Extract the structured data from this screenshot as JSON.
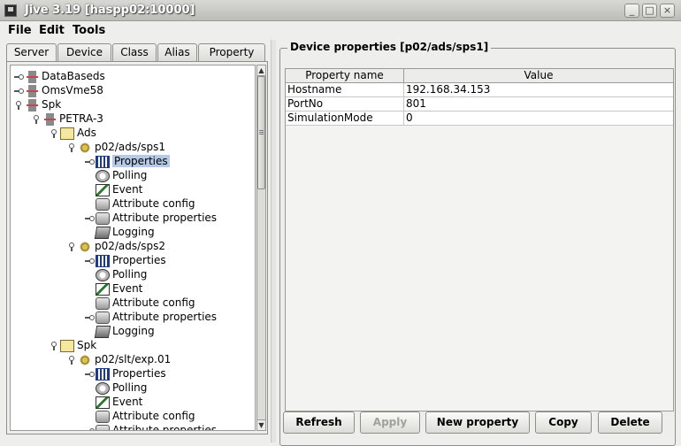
{
  "window": {
    "title": "Jive 3.19  [haspp02:10000]",
    "buttons": [
      "_",
      "□",
      "×"
    ]
  },
  "menu": [
    "File",
    "Edit",
    "Tools"
  ],
  "tabs": [
    {
      "label": "Server",
      "active": true
    },
    {
      "label": "Device",
      "active": false
    },
    {
      "label": "Class",
      "active": false
    },
    {
      "label": "Alias",
      "active": false
    },
    {
      "label": "Property",
      "active": false
    }
  ],
  "tree": [
    {
      "label": "DataBaseds",
      "icon": "server-icon",
      "level": 0,
      "state": "collapsed"
    },
    {
      "label": "OmsVme58",
      "icon": "server-icon",
      "level": 0,
      "state": "collapsed"
    },
    {
      "label": "Spk",
      "icon": "server-icon",
      "level": 0,
      "state": "expanded"
    },
    {
      "label": "PETRA-3",
      "icon": "instance-icon",
      "level": 1,
      "state": "expanded"
    },
    {
      "label": "Ads",
      "icon": "class-icon",
      "level": 2,
      "state": "expanded"
    },
    {
      "label": "p02/ads/sps1",
      "icon": "device-icon",
      "level": 3,
      "state": "expanded"
    },
    {
      "label": "Properties",
      "icon": "properties-icon",
      "level": 4,
      "state": "collapsed",
      "selected": true
    },
    {
      "label": "Polling",
      "icon": "polling-icon",
      "level": 4,
      "state": "none"
    },
    {
      "label": "Event",
      "icon": "event-icon",
      "level": 4,
      "state": "none"
    },
    {
      "label": "Attribute config",
      "icon": "attribute-config-icon",
      "level": 4,
      "state": "none"
    },
    {
      "label": "Attribute properties",
      "icon": "attribute-properties-icon",
      "level": 4,
      "state": "collapsed"
    },
    {
      "label": "Logging",
      "icon": "logging-icon",
      "level": 4,
      "state": "none"
    },
    {
      "label": "p02/ads/sps2",
      "icon": "device-icon",
      "level": 3,
      "state": "expanded"
    },
    {
      "label": "Properties",
      "icon": "properties-icon",
      "level": 4,
      "state": "collapsed"
    },
    {
      "label": "Polling",
      "icon": "polling-icon",
      "level": 4,
      "state": "none"
    },
    {
      "label": "Event",
      "icon": "event-icon",
      "level": 4,
      "state": "none"
    },
    {
      "label": "Attribute config",
      "icon": "attribute-config-icon",
      "level": 4,
      "state": "none"
    },
    {
      "label": "Attribute properties",
      "icon": "attribute-properties-icon",
      "level": 4,
      "state": "collapsed"
    },
    {
      "label": "Logging",
      "icon": "logging-icon",
      "level": 4,
      "state": "none"
    },
    {
      "label": "Spk",
      "icon": "class-icon",
      "level": 2,
      "state": "expanded"
    },
    {
      "label": "p02/slt/exp.01",
      "icon": "device-icon",
      "level": 3,
      "state": "expanded"
    },
    {
      "label": "Properties",
      "icon": "properties-icon",
      "level": 4,
      "state": "collapsed"
    },
    {
      "label": "Polling",
      "icon": "polling-icon",
      "level": 4,
      "state": "none"
    },
    {
      "label": "Event",
      "icon": "event-icon",
      "level": 4,
      "state": "none"
    },
    {
      "label": "Attribute config",
      "icon": "attribute-config-icon",
      "level": 4,
      "state": "none"
    },
    {
      "label": "Attribute properties",
      "icon": "attribute-properties-icon",
      "level": 4,
      "state": "collapsed"
    }
  ],
  "device_properties": {
    "title": "Device properties [p02/ads/sps1]",
    "columns": [
      "Property name",
      "Value"
    ],
    "rows": [
      [
        "Hostname",
        "192.168.34.153"
      ],
      [
        "PortNo",
        "801"
      ],
      [
        "SimulationMode",
        "0"
      ]
    ]
  },
  "buttons": {
    "refresh": "Refresh",
    "apply": "Apply",
    "new_property": "New property",
    "copy": "Copy",
    "delete": "Delete"
  },
  "colors": {
    "selection": "#b6c9e6",
    "window_bg": "#eeeeec"
  }
}
